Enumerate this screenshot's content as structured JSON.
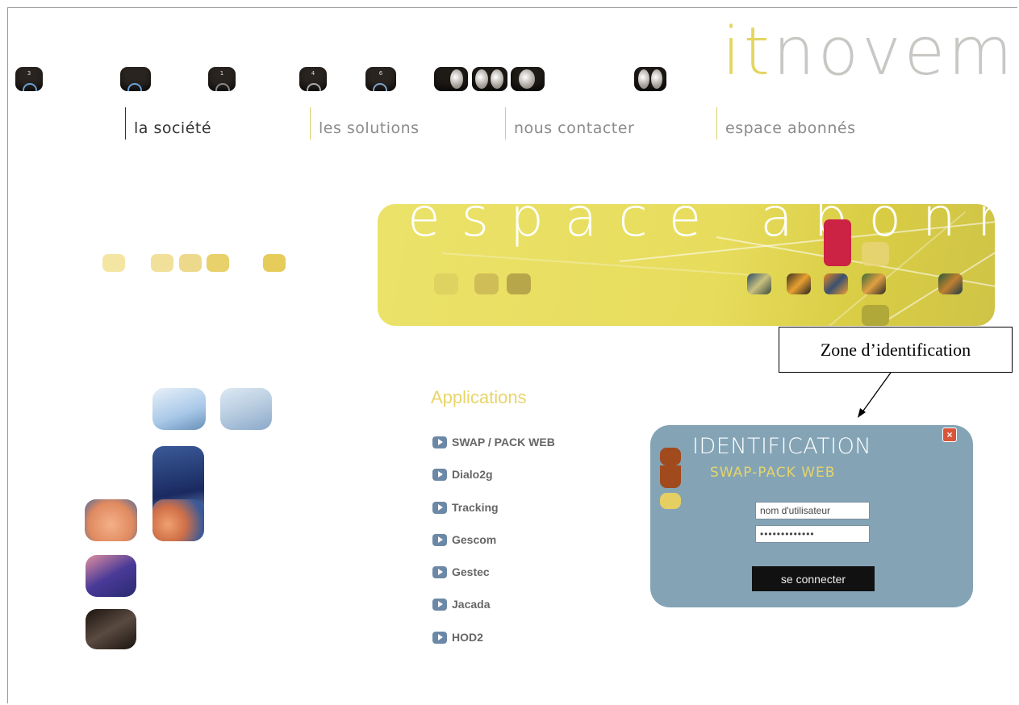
{
  "header": {
    "logo_prefix": "it",
    "logo_main": "novem",
    "logo_dot": ".",
    "tiles": [
      {
        "num": "3"
      },
      {
        "num": ""
      },
      {
        "num": "1"
      },
      {
        "num": "4"
      },
      {
        "num": "6"
      }
    ]
  },
  "nav": {
    "items": [
      {
        "label": "la société"
      },
      {
        "label": "les solutions"
      },
      {
        "label": "nous contacter"
      },
      {
        "label": "espace abonnés"
      }
    ]
  },
  "banner": {
    "title": "espace abonnes"
  },
  "applications": {
    "title": "Applications",
    "items": [
      {
        "label": "SWAP / PACK WEB"
      },
      {
        "label": "Dialo2g"
      },
      {
        "label": "Tracking"
      },
      {
        "label": "Gescom"
      },
      {
        "label": "Gestec"
      },
      {
        "label": "Jacada"
      },
      {
        "label": "HOD2"
      }
    ]
  },
  "annotation": {
    "label": "Zone d’identification"
  },
  "login": {
    "title": "IDENTIFICATION",
    "subtitle": "SWAP-PACK WEB",
    "close_label": "×",
    "username_value": "nom d'utilisateur",
    "password_value": "•••••••••••••",
    "submit_label": "se connecter"
  },
  "colors": {
    "accent_yellow": "#e3d660",
    "login_bg": "#84a4b6",
    "banner_yellow": "#e7dc5c",
    "brand_red": "#cc2244",
    "brown": "#a04a1e"
  },
  "icons": [
    "dark-tile-icon",
    "moon-tile-icon",
    "play-icon",
    "close-icon"
  ]
}
